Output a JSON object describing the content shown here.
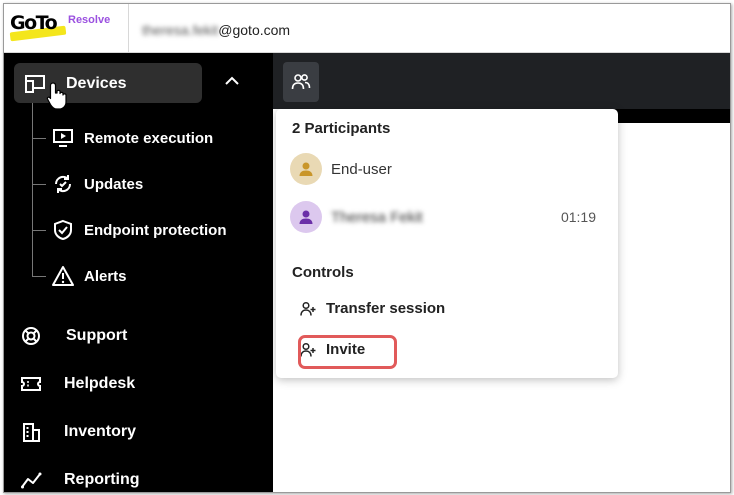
{
  "header": {
    "logo_text": "GoTo",
    "logo_product": "Resolve",
    "user_name": "theresa.fekit",
    "user_domain": "@goto.com"
  },
  "sidebar": {
    "devices": {
      "label": "Devices",
      "children": [
        {
          "label": "Remote execution",
          "icon": "monitor-play-icon"
        },
        {
          "label": "Updates",
          "icon": "refresh-icon"
        },
        {
          "label": "Endpoint protection",
          "icon": "shield-check-icon"
        },
        {
          "label": "Alerts",
          "icon": "warning-triangle-icon"
        }
      ]
    },
    "items": [
      {
        "label": "Support",
        "icon": "lifebuoy-icon"
      },
      {
        "label": "Helpdesk",
        "icon": "ticket-icon"
      },
      {
        "label": "Inventory",
        "icon": "building-icon"
      },
      {
        "label": "Reporting",
        "icon": "line-chart-icon"
      }
    ]
  },
  "participants_panel": {
    "title": "2 Participants",
    "participants": [
      {
        "name": "End-user",
        "time": "",
        "avatar_color": "#e9d9b4",
        "icon_color": "#c9962a"
      },
      {
        "name": "Theresa Fekit",
        "time": "01:19",
        "avatar_color": "#dcc8ee",
        "icon_color": "#6b2fa8"
      }
    ],
    "controls_title": "Controls",
    "controls": [
      {
        "label": "Transfer session"
      },
      {
        "label": "Invite"
      }
    ]
  },
  "colors": {
    "accent_purple": "#9b51e0",
    "logo_yellow": "#f4e61c",
    "highlight_red": "#e15a5a"
  }
}
